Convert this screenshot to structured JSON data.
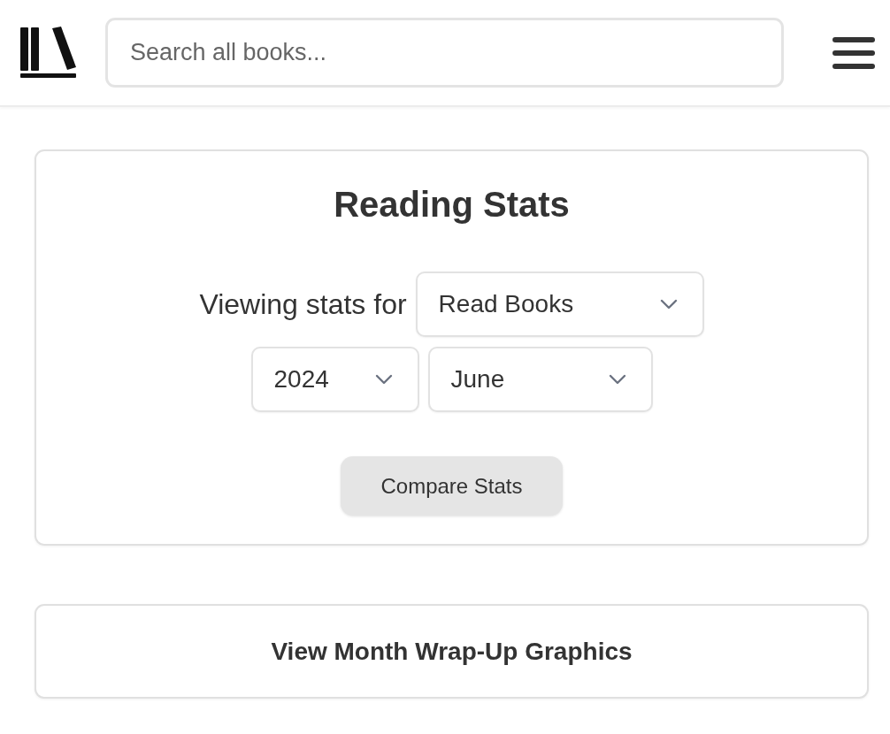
{
  "header": {
    "search": {
      "placeholder": "Search all books..."
    }
  },
  "stats_card": {
    "title": "Reading Stats",
    "label": "Viewing stats for",
    "dropdowns": [
      {
        "value": "Read Books"
      },
      {
        "value": "2024"
      },
      {
        "value": "June"
      }
    ],
    "button": "Compare Stats"
  },
  "wrap_up_card": {
    "title": "View Month Wrap-Up Graphics"
  }
}
